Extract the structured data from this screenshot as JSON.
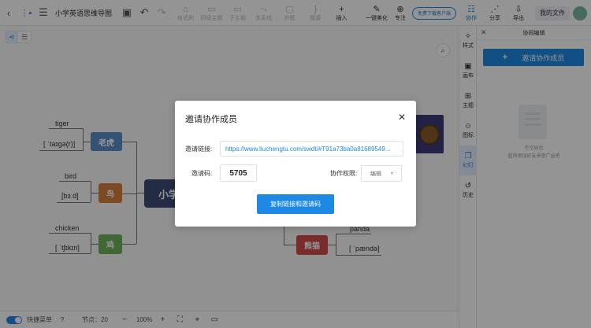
{
  "toolbar": {
    "doc_title": "小学英语思维导图",
    "tools": [
      {
        "label": "格式刷",
        "icon": "format-brush-icon",
        "glyph": "⌂"
      },
      {
        "label": "同级主题",
        "icon": "sibling-topic-icon",
        "glyph": "▭"
      },
      {
        "label": "子主题",
        "icon": "child-topic-icon",
        "glyph": "▭"
      },
      {
        "label": "关系线",
        "icon": "relation-line-icon",
        "glyph": "⤳"
      },
      {
        "label": "外框",
        "icon": "frame-icon",
        "glyph": "▢"
      },
      {
        "label": "概要",
        "icon": "summary-icon",
        "glyph": "}"
      },
      {
        "label": "插入",
        "icon": "insert-icon",
        "glyph": "+"
      }
    ],
    "beautify_label": "一键美化",
    "focus_label": "专注",
    "free_download_label": "免费下载客户端",
    "collab_label": "协作",
    "share_label": "分享",
    "export_label": "导出",
    "my_files_label": "我的文件"
  },
  "canvas": {
    "root_label": "小学",
    "branches": [
      {
        "label": "老虎",
        "color": "#5b8fc9",
        "word": "tiger",
        "phonetic": "[ ˈtaɪɡə(r)]"
      },
      {
        "label": "鸟",
        "color": "#d9803b",
        "word": "bird",
        "phonetic": "[bɜːd]"
      },
      {
        "label": "鸡",
        "color": "#6fb45a",
        "word": "chicken",
        "phonetic": "[ ˈtʃɪkɪn]"
      },
      {
        "label": "熊猫",
        "color": "#d24a4a",
        "word": "panda",
        "phonetic": "[ ˈpændə]"
      }
    ]
  },
  "bottombar": {
    "quick_menu_label": "快捷菜单",
    "node_count_label": "节点：20",
    "zoom_label": "100%"
  },
  "rail": {
    "items": [
      {
        "label": "样式",
        "icon": "style-icon",
        "glyph": "✧"
      },
      {
        "label": "画布",
        "icon": "canvas-icon",
        "glyph": "▣"
      },
      {
        "label": "主题",
        "icon": "theme-icon",
        "glyph": "⊞"
      },
      {
        "label": "图标",
        "icon": "emoji-icon",
        "glyph": "☺"
      },
      {
        "label": "幻灯",
        "icon": "slides-icon",
        "glyph": "❐"
      },
      {
        "label": "历史",
        "icon": "history-icon",
        "glyph": "↺"
      }
    ]
  },
  "panel": {
    "title": "协同编辑",
    "invite_button": "邀请协作成员",
    "empty_line1": "空空如也",
    "empty_line2": "赶快添加好友来思广益吧"
  },
  "modal": {
    "title": "邀请协作成员",
    "link_label": "邀请链接:",
    "link_value": "https://www.liuchengtu.com/swdt/#T91a73ba0a81689549...",
    "code_label": "邀请码:",
    "code_value": "5705",
    "permission_label": "协作权限:",
    "permission_value": "编辑",
    "copy_button": "复制链接和邀请码"
  }
}
